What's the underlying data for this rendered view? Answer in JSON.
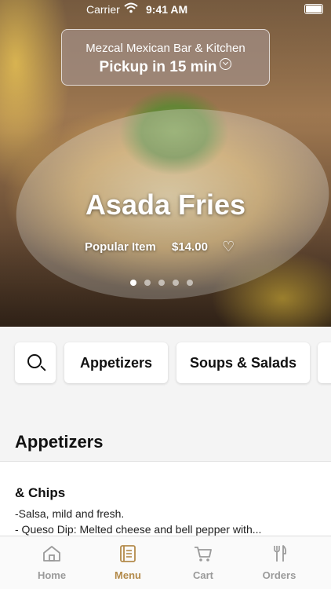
{
  "status_bar": {
    "carrier": "Carrier",
    "time": "9:41 AM"
  },
  "store": {
    "name": "Mezcal Mexican Bar & Kitchen",
    "pickup": "Pickup in 15 min"
  },
  "featured": {
    "title": "Asada Fries",
    "tag": "Popular Item",
    "price": "$14.00",
    "page_count": 5,
    "active_page": 1
  },
  "categories": [
    "Appetizers",
    "Soups & Salads"
  ],
  "section": {
    "title": "Appetizers"
  },
  "menu_items": [
    {
      "title": "& Chips",
      "description_line1": "-Salsa, mild and fresh.",
      "description_line2": " - Queso Dip: Melted cheese and bell pepper with..."
    }
  ],
  "tabs": [
    {
      "label": "Home",
      "icon": "home-icon",
      "active": false
    },
    {
      "label": "Menu",
      "icon": "menu-book-icon",
      "active": true
    },
    {
      "label": "Cart",
      "icon": "cart-icon",
      "active": false
    },
    {
      "label": "Orders",
      "icon": "utensils-icon",
      "active": false
    }
  ],
  "colors": {
    "accent": "#b38a4a",
    "inactive_tab": "#9a9a9a"
  }
}
